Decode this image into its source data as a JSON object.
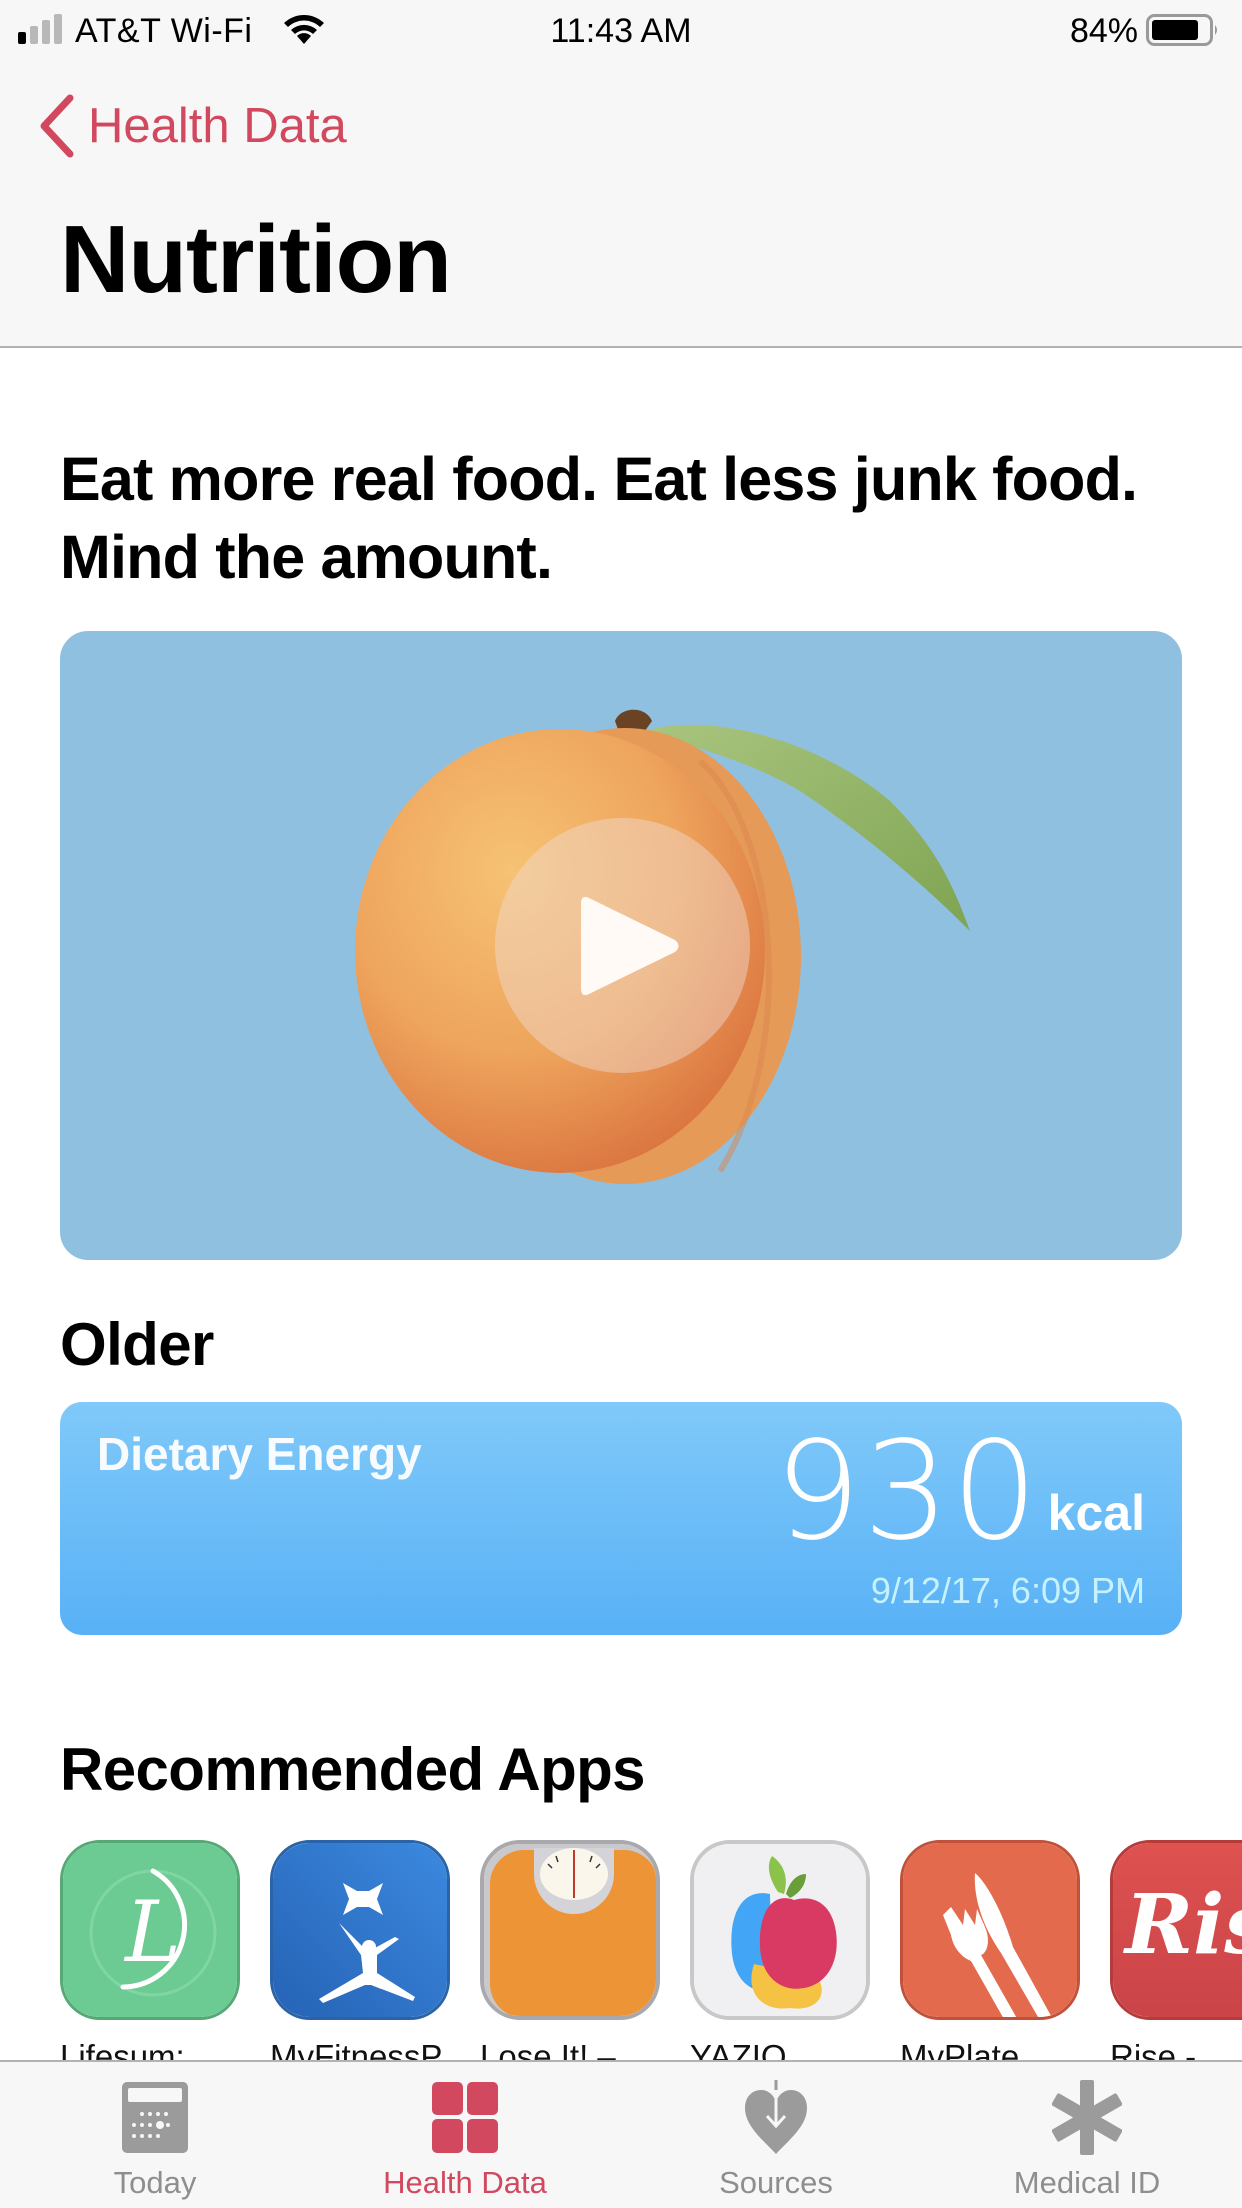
{
  "status_bar": {
    "carrier": "AT&T Wi-Fi",
    "time": "11:43 AM",
    "battery_percent": "84%",
    "battery_level": 0.84,
    "signal_bars": 1,
    "signal_bars_total": 4
  },
  "nav": {
    "back_label": "Health Data",
    "title": "Nutrition"
  },
  "intro": {
    "headline": "Eat more real food. Eat less junk food. Mind the amount.",
    "video": {
      "icon": "play-icon",
      "subject": "apricot"
    }
  },
  "older": {
    "section_title": "Older",
    "card": {
      "label": "Dietary Energy",
      "value": "930",
      "unit": "kcal",
      "timestamp": "9/12/17, 6:09 PM"
    }
  },
  "recommended_apps": {
    "section_title": "Recommended Apps",
    "items": [
      {
        "name": "Lifesum:",
        "icon": "lifesum-icon"
      },
      {
        "name": "MyFitnessP",
        "icon": "myfitnesspal-icon"
      },
      {
        "name": "Lose It! –",
        "icon": "lose-it-icon"
      },
      {
        "name": "YAZIO",
        "icon": "yazio-icon"
      },
      {
        "name": "MyPlate",
        "icon": "myplate-icon"
      },
      {
        "name": "Rise -",
        "icon": "rise-icon"
      }
    ]
  },
  "tab_bar": {
    "active": "Health Data",
    "items": [
      {
        "label": "Today",
        "icon": "calendar-icon"
      },
      {
        "label": "Health Data",
        "icon": "grid-icon"
      },
      {
        "label": "Sources",
        "icon": "heart-download-icon"
      },
      {
        "label": "Medical ID",
        "icon": "asterisk-icon"
      }
    ]
  },
  "colors": {
    "accent": "#d2485e",
    "inactive_tab": "#8e8e8e",
    "video_bg": "#90c0e0",
    "energy_card_top": "#80c9f9",
    "energy_card_bottom": "#58b1f6"
  }
}
